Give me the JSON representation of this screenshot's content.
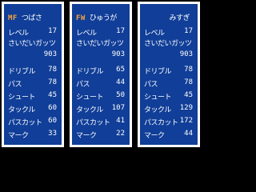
{
  "panels": [
    {
      "position": "MF",
      "name": "つばさ",
      "stats": [
        {
          "label": "レベル",
          "value": "17"
        },
        {
          "label": "さいだいガッツ",
          "value": ""
        },
        {
          "label": "",
          "value": "903"
        },
        {
          "label": "ドリブル",
          "value": "78"
        },
        {
          "label": "パス",
          "value": "78"
        },
        {
          "label": "シュート",
          "value": "45"
        },
        {
          "label": "タックル",
          "value": "60"
        },
        {
          "label": "パスカット",
          "value": "60"
        },
        {
          "label": "マーク",
          "value": "33"
        }
      ]
    },
    {
      "position": "FW",
      "name": "ひゅうが",
      "stats": [
        {
          "label": "レベル",
          "value": "17"
        },
        {
          "label": "さいだいガッツ",
          "value": ""
        },
        {
          "label": "",
          "value": "903"
        },
        {
          "label": "ドリブル",
          "value": "65"
        },
        {
          "label": "パス",
          "value": "44"
        },
        {
          "label": "シュート",
          "value": "50"
        },
        {
          "label": "タックル",
          "value": "107"
        },
        {
          "label": "パスカット",
          "value": "41"
        },
        {
          "label": "マーク",
          "value": "22"
        }
      ]
    },
    {
      "position": "",
      "name": "みすぎ",
      "stats": [
        {
          "label": "レベル",
          "value": "17"
        },
        {
          "label": "さいだいガッツ",
          "value": ""
        },
        {
          "label": "",
          "value": "903"
        },
        {
          "label": "ドリブル",
          "value": "78"
        },
        {
          "label": "パス",
          "value": "78"
        },
        {
          "label": "シュート",
          "value": "45"
        },
        {
          "label": "タックル",
          "value": "129"
        },
        {
          "label": "パスカット",
          "value": "172"
        },
        {
          "label": "マーク",
          "value": "44"
        }
      ]
    }
  ],
  "colors": {
    "panel_bg": "#103e98",
    "border": "#ffffff",
    "position_tag": "#f6a23a",
    "text": "#ffffff"
  }
}
